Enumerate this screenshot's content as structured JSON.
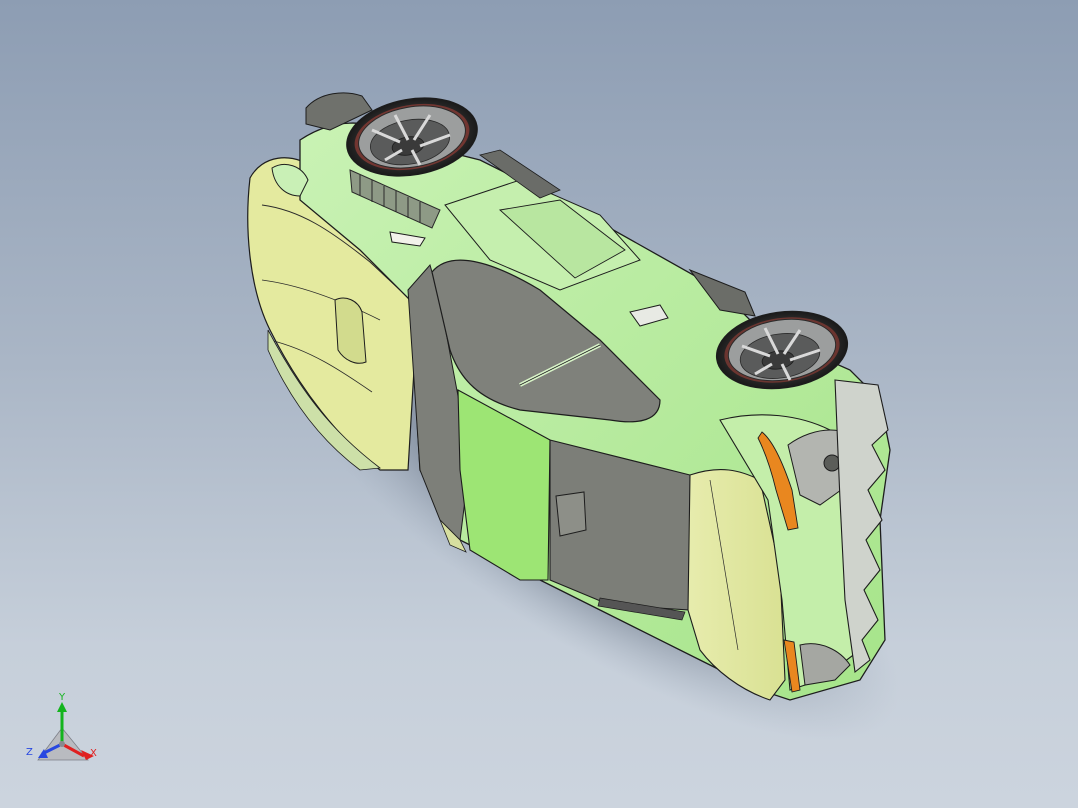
{
  "viewport": {
    "background_top": "#8d9db3",
    "background_bottom": "#ccd4de"
  },
  "model": {
    "colors": {
      "body_green": "#b6ec9e",
      "body_light": "#d6f6c4",
      "panel_yellow": "#e2ea9c",
      "panel_yellow_light": "#eef2bd",
      "door_green": "#9ce472",
      "glass_gray": "#7e807a",
      "tire_black": "#2a2a2a",
      "rim_gray": "#9a9c9c",
      "grille_gray": "#a9aba6",
      "indicator_orange": "#e9871f",
      "edge_black": "#1d1d1d"
    }
  },
  "triad": {
    "labels": {
      "y": "Y",
      "z": "Z",
      "x": "X"
    },
    "colors": {
      "y": "#14b41e",
      "z": "#2847e0",
      "x": "#e02020"
    }
  }
}
